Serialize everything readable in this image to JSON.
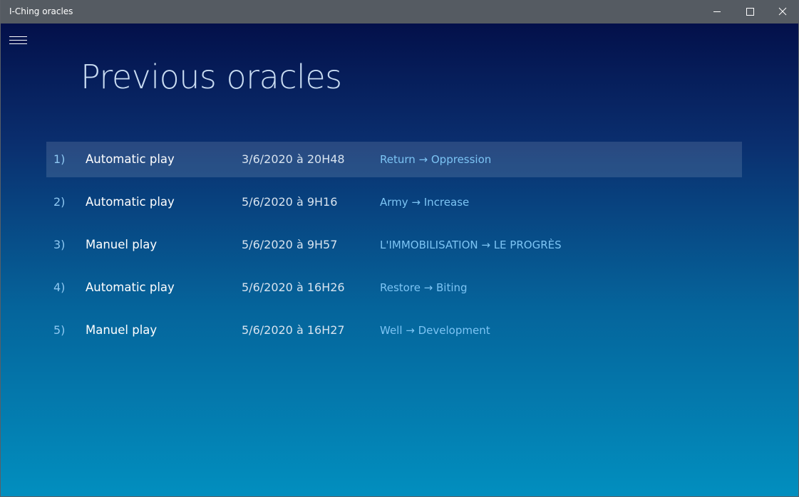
{
  "window": {
    "title": "I-Ching oracles",
    "controls": {
      "minimize_icon": "minimize-icon",
      "maximize_icon": "maximize-icon",
      "close_icon": "close-icon"
    }
  },
  "nav": {
    "menu_icon": "hamburger-icon"
  },
  "page": {
    "title": "Previous oracles"
  },
  "oracles": [
    {
      "num": "1)",
      "type": "Automatic play",
      "date": "3/6/2020 à 20H48",
      "result": "Return → Oppression",
      "selected": true
    },
    {
      "num": "2)",
      "type": "Automatic play",
      "date": "5/6/2020 à 9H16",
      "result": "Army → Increase",
      "selected": false
    },
    {
      "num": "3)",
      "type": "Manuel play",
      "date": "5/6/2020 à 9H57",
      "result": "L'IMMOBILISATION → LE PROGRÈS",
      "selected": false
    },
    {
      "num": "4)",
      "type": "Automatic play",
      "date": "5/6/2020 à 16H26",
      "result": "Restore → Biting",
      "selected": false
    },
    {
      "num": "5)",
      "type": "Manuel play",
      "date": "5/6/2020 à 16H27",
      "result": "Well → Development",
      "selected": false
    }
  ],
  "colors": {
    "titlebar": "#555b62",
    "background_top": "#03104a",
    "background_bottom": "#028fbf",
    "title_text": "#c9dcf2",
    "result_text": "#7cc4f4"
  }
}
